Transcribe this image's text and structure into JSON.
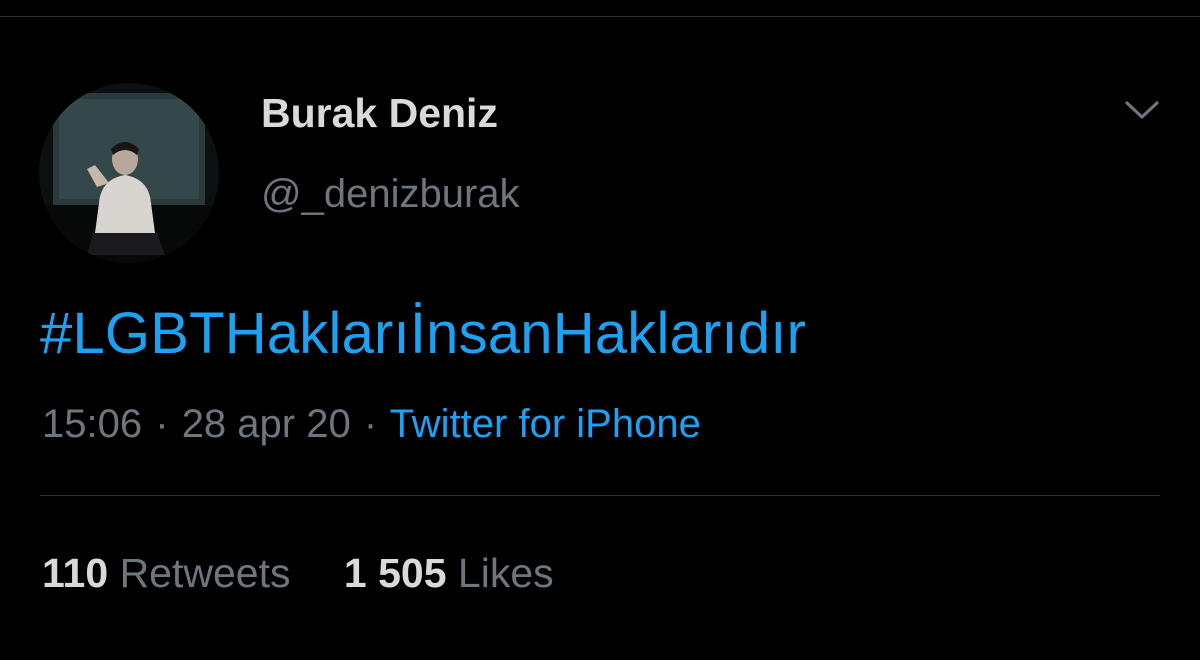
{
  "tweet": {
    "author": {
      "display_name": "Burak Deniz",
      "handle": "@_denizburak"
    },
    "text": "#LGBTHaklarıİnsanHaklarıdır",
    "time": "15:06",
    "date": "28 apr 20",
    "separator": "·",
    "source": "Twitter for iPhone",
    "stats": {
      "retweets_count": "110",
      "retweets_label": "Retweets",
      "likes_count": "1 505",
      "likes_label": "Likes"
    }
  },
  "icons": {
    "more": "chevron-down-icon"
  },
  "colors": {
    "background": "#000000",
    "text_primary": "#d9d9d9",
    "text_secondary": "#6e767d",
    "accent": "#1da1f2",
    "divider": "#2f3336"
  }
}
